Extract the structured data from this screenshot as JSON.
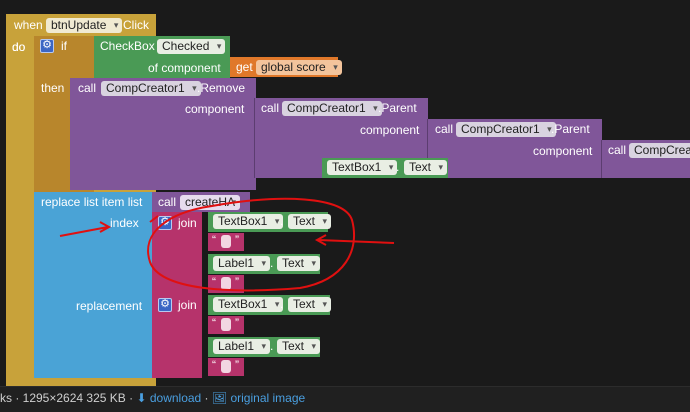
{
  "event": {
    "when_label": "when",
    "component": "btnUpdate",
    "event_name": "Click",
    "do_label": "do"
  },
  "if_block": {
    "if_label": "if",
    "then_label": "then",
    "checkbox_component": "CheckBox",
    "checkbox_property": "Checked",
    "of_component_label": "of component",
    "get_label": "get",
    "get_variable": "global score"
  },
  "remove_call": {
    "call_label": "call",
    "component": "CompCreator1",
    "method": ".Remove",
    "component_label": "component",
    "parent_call_1": {
      "call_label": "call",
      "component": "CompCreator1",
      "method": ".Parent",
      "component_label": "component"
    },
    "parent_call_2": {
      "call_label": "call",
      "component": "CompCreator1",
      "method": ".Parent",
      "component_label": "component"
    },
    "parent_call_3": {
      "call_label": "call",
      "component": "CompCrea"
    },
    "textbox": {
      "component": "TextBox1",
      "dot": ".",
      "property": "Text"
    }
  },
  "replace": {
    "label": "replace list item  list",
    "index_label": "index",
    "replacement_label": "replacement",
    "call_label": "call",
    "procedure": "createHA",
    "join1": {
      "label": "join",
      "tb": "TextBox1",
      "tb_prop": "Text",
      "lb": "Label1",
      "lb_prop": "Text",
      "dot": "."
    },
    "join2": {
      "label": "join",
      "tb": "TextBox1",
      "tb_prop": "Text",
      "lb": "Label1",
      "lb_prop": "Text",
      "dot": "."
    },
    "quote_open": "“",
    "quote_close": "”"
  },
  "status_bar": {
    "info": "ks · 1295×2624 325 KB · ",
    "download_icon": "download-icon",
    "download_label": "download",
    "separator": " · ",
    "image_icon": "image-icon",
    "original_label": "original image"
  },
  "colors": {
    "event": "#c8a23a",
    "procedure": "#805699",
    "logic": "#4a9a55",
    "list": "#4aa3d6",
    "text": "#b6336b",
    "variable": "#e0782a",
    "annotation": "#e01010"
  }
}
